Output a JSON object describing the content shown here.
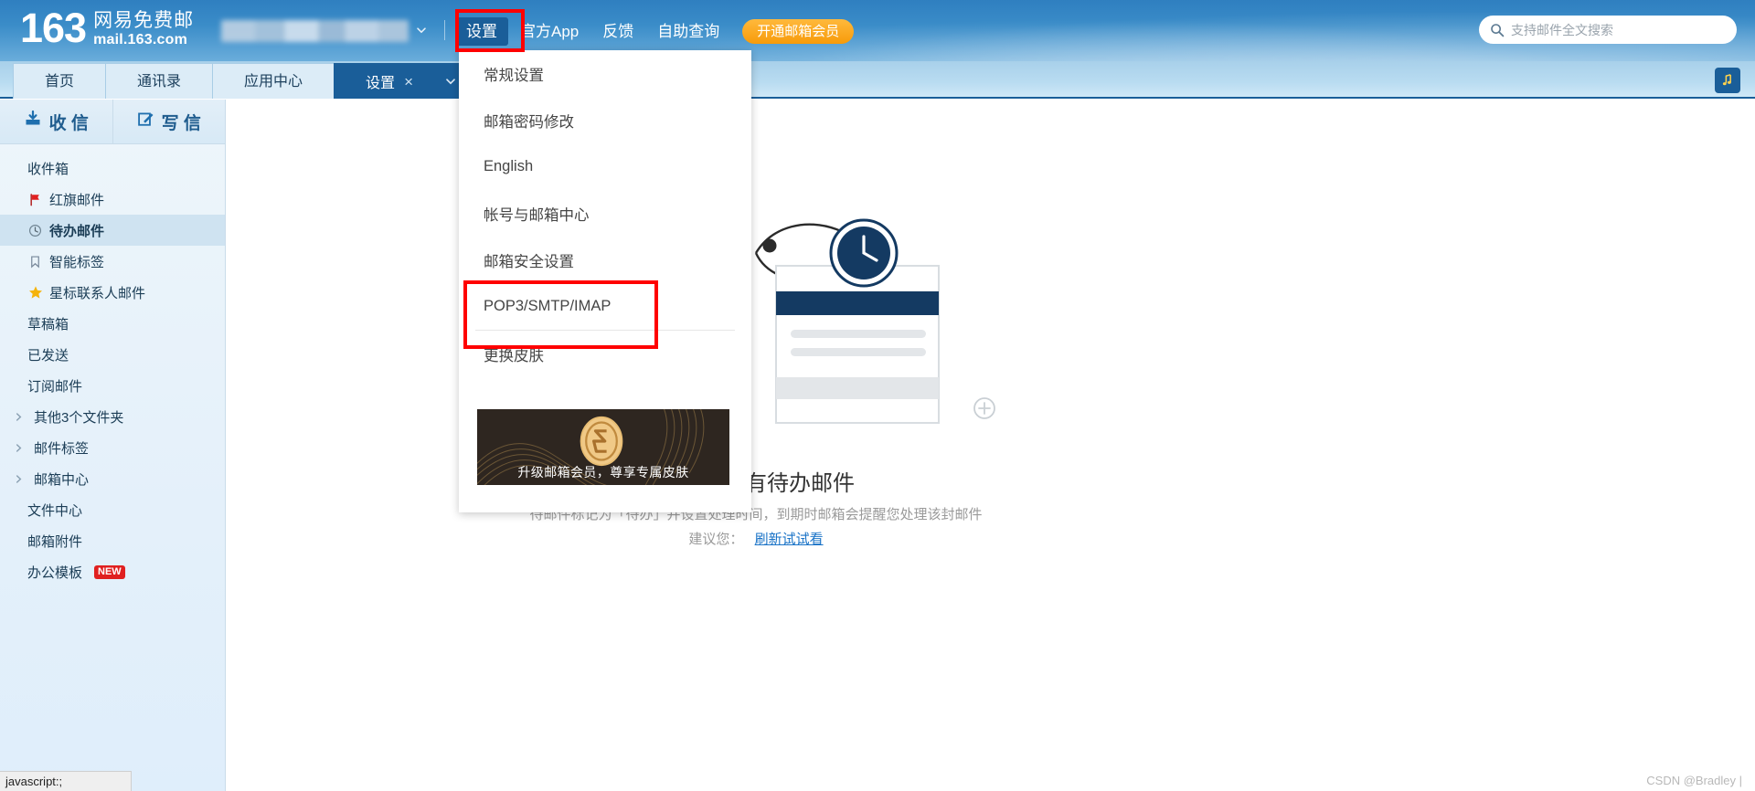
{
  "header": {
    "logo_number": "163",
    "logo_cn": "网易免费邮",
    "logo_url": "mail.163.com",
    "account_caret_icon": "chevron-down-icon",
    "nav_items": [
      {
        "label": "设置",
        "active": true
      },
      {
        "label": "官方App",
        "active": false
      },
      {
        "label": "反馈",
        "active": false
      },
      {
        "label": "自助查询",
        "active": false
      }
    ],
    "vip_label": "开通邮箱会员",
    "search": {
      "icon": "search-icon",
      "placeholder": "支持邮件全文搜索",
      "value": ""
    }
  },
  "tabbar": {
    "tabs": [
      {
        "label": "首页",
        "active": false
      },
      {
        "label": "通讯录",
        "active": false
      },
      {
        "label": "应用中心",
        "active": false
      },
      {
        "label": "设置",
        "active": true,
        "close_icon": "close-icon"
      }
    ],
    "caret_icon": "chevron-down-icon",
    "music_icon": "music-note-icon"
  },
  "sidebar": {
    "actions": [
      {
        "label": "收 信",
        "icon": "inbox-download-icon"
      },
      {
        "label": "写 信",
        "icon": "compose-pencil-icon"
      }
    ],
    "items": [
      {
        "label": "收件箱",
        "icon": null,
        "selected": false,
        "expandable": false
      },
      {
        "label": "红旗邮件",
        "icon": "red-flag-icon",
        "selected": false,
        "expandable": false
      },
      {
        "label": "待办邮件",
        "icon": "clock-icon",
        "selected": true,
        "expandable": false
      },
      {
        "label": "智能标签",
        "icon": "bookmark-icon",
        "selected": false,
        "expandable": false
      },
      {
        "label": "星标联系人邮件",
        "icon": "gold-star-icon",
        "selected": false,
        "expandable": false
      },
      {
        "label": "草稿箱",
        "icon": null,
        "selected": false,
        "expandable": false
      },
      {
        "label": "已发送",
        "icon": null,
        "selected": false,
        "expandable": false
      },
      {
        "label": "订阅邮件",
        "icon": null,
        "selected": false,
        "expandable": false
      },
      {
        "label": "其他3个文件夹",
        "icon": null,
        "selected": false,
        "expandable": true
      },
      {
        "label": "邮件标签",
        "icon": null,
        "selected": false,
        "expandable": true
      },
      {
        "label": "邮箱中心",
        "icon": null,
        "selected": false,
        "expandable": true
      },
      {
        "label": "文件中心",
        "icon": null,
        "selected": false,
        "expandable": false
      },
      {
        "label": "邮箱附件",
        "icon": null,
        "selected": false,
        "expandable": false
      },
      {
        "label": "办公模板",
        "icon": null,
        "selected": false,
        "expandable": false,
        "badge": "NEW"
      }
    ]
  },
  "dropdown": {
    "items": [
      {
        "label": "常规设置"
      },
      {
        "label": "邮箱密码修改"
      },
      {
        "label": "English"
      },
      {
        "label": "帐号与邮箱中心"
      },
      {
        "label": "邮箱安全设置"
      },
      {
        "label": "POP3/SMTP/IMAP",
        "highlighted": true
      },
      {
        "label": "更换皮肤"
      }
    ],
    "banner": {
      "text": "升级邮箱会员，尊享专属皮肤",
      "coin_icon": "gold-coin-s-icon"
    }
  },
  "main": {
    "empty_title": "您目前没有待办邮件",
    "empty_sub": "待邮件标记为「待办」并设置处理时间，到期时邮箱会提醒您处理该封邮件",
    "empty_sub2_prefix": "建议您：",
    "empty_sub2_link": "刷新试试看",
    "illustration_icon": "person-with-clock-illustration"
  },
  "statusbar": {
    "text": "javascript:;"
  },
  "watermark": {
    "text": "CSDN @Bradley |"
  },
  "colors": {
    "brand_blue": "#1a5e99",
    "header_gradient_top": "#2f7fc0",
    "annotation_red": "#ff0000",
    "badge_red": "#e02020",
    "vip_orange": "#f79b0a",
    "link_blue": "#1a73c7",
    "banner_dark": "#2e2620",
    "banner_gold": "#e9c98a"
  }
}
